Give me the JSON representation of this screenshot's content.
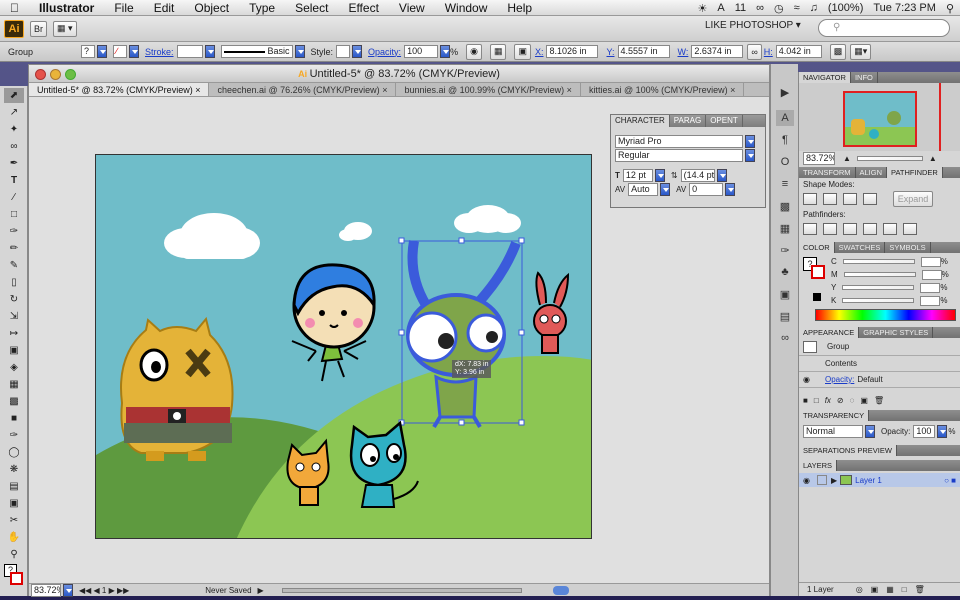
{
  "menubar": {
    "app": "Illustrator",
    "items": [
      "File",
      "Edit",
      "Object",
      "Type",
      "Select",
      "Effect",
      "View",
      "Window",
      "Help"
    ],
    "status_num": "11",
    "battery": "(100%)",
    "clock": "Tue 7:23 PM"
  },
  "appbar": {
    "logo": "Ai",
    "workspace": "LIKE PHOTOSHOP ▾"
  },
  "control": {
    "selection": "Group",
    "stroke_label": "Stroke:",
    "brush": "Basic",
    "style_label": "Style:",
    "opacity_label": "Opacity:",
    "opacity_value": "100",
    "opacity_unit": "%",
    "x_label": "X:",
    "x_value": "8.1026 in",
    "y_label": "Y:",
    "y_value": "4.5557 in",
    "w_label": "W:",
    "w_value": "2.6374 in",
    "h_label": "H:",
    "h_value": "4.042 in"
  },
  "document": {
    "title": "Untitled-5* @ 83.72% (CMYK/Preview)",
    "tabs": [
      "Untitled-5* @ 83.72% (CMYK/Preview)",
      "cheechen.ai @ 76.26% (CMYK/Preview)",
      "bunnies.ai @ 100.99% (CMYK/Preview)",
      "kitties.ai @ 100% (CMYK/Preview)"
    ],
    "tooltip_x": "dX: 7.83 in",
    "tooltip_y": "Y: 3.96 in"
  },
  "status": {
    "zoom": "83.72%",
    "doc_state": "Never Saved"
  },
  "character": {
    "tabs": [
      "CHARACTER",
      "PARAG",
      "OPENT"
    ],
    "font": "Myriad Pro",
    "style": "Regular",
    "size": "12 pt",
    "leading": "(14.4 pt)",
    "kerning": "Auto",
    "tracking": "0"
  },
  "navigator": {
    "tabs": [
      "NAVIGATOR",
      "INFO"
    ],
    "zoom": "83.72%"
  },
  "pathfinder": {
    "tabs": [
      "TRANSFORM",
      "ALIGN",
      "PATHFINDER"
    ],
    "shape_modes": "Shape Modes:",
    "pathfinders": "Pathfinders:",
    "expand": "Expand"
  },
  "color": {
    "tabs": [
      "COLOR",
      "SWATCHES",
      "SYMBOLS"
    ],
    "channels": [
      "C",
      "M",
      "Y",
      "K"
    ],
    "unit": "%"
  },
  "appearance": {
    "tabs": [
      "APPEARANCE",
      "GRAPHIC STYLES"
    ],
    "group": "Group",
    "contents": "Contents",
    "opacity_label": "Opacity:",
    "opacity_value": "Default"
  },
  "transparency": {
    "tab": "TRANSPARENCY",
    "mode": "Normal",
    "opacity_label": "Opacity:",
    "opacity_value": "100",
    "unit": "%"
  },
  "separations": {
    "tab": "SEPARATIONS PREVIEW"
  },
  "layers": {
    "tab": "LAYERS",
    "layer1": "Layer 1",
    "count": "1 Layer"
  },
  "colors": {
    "ai_orange": "#f7a823",
    "sky": "#6fbdc9",
    "hill": "#8cc653",
    "selection": "#3b5bdb"
  }
}
